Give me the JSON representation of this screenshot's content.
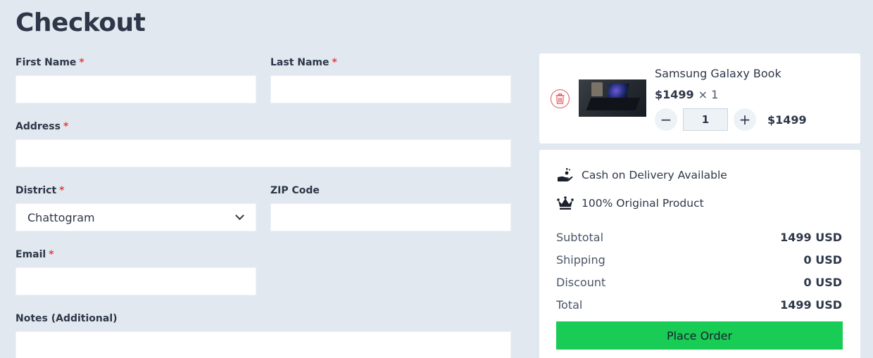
{
  "page": {
    "title": "Checkout"
  },
  "form": {
    "first_name": {
      "label": "First Name",
      "required_mark": "*",
      "value": ""
    },
    "last_name": {
      "label": "Last Name",
      "required_mark": "*",
      "value": ""
    },
    "address": {
      "label": "Address",
      "required_mark": "*",
      "value": ""
    },
    "district": {
      "label": "District",
      "required_mark": "*",
      "selected": "Chattogram"
    },
    "zip": {
      "label": "ZIP Code",
      "value": ""
    },
    "email": {
      "label": "Email",
      "required_mark": "*",
      "value": ""
    },
    "notes": {
      "label": "Notes (Additional)",
      "value": ""
    }
  },
  "cart": {
    "item": {
      "name": "Samsung Galaxy Book",
      "unit_price": "$1499",
      "times": "× 1",
      "quantity": "1",
      "line_total": "$1499",
      "minus": "−",
      "plus": "+"
    }
  },
  "summary": {
    "features": [
      {
        "icon": "hand-coin-icon",
        "text": "Cash on Delivery Available"
      },
      {
        "icon": "crown-icon",
        "text": "100% Original Product"
      }
    ],
    "rows": [
      {
        "label": "Subtotal",
        "value": "1499 USD"
      },
      {
        "label": "Shipping",
        "value": "0 USD"
      },
      {
        "label": "Discount",
        "value": "0 USD"
      },
      {
        "label": "Total",
        "value": "1499 USD"
      }
    ],
    "place_order_label": "Place Order"
  },
  "colors": {
    "background": "#e2e8f0",
    "text": "#2d3748",
    "required": "#e53e3e",
    "accent_button": "#19cc55",
    "trash": "#e05252"
  }
}
